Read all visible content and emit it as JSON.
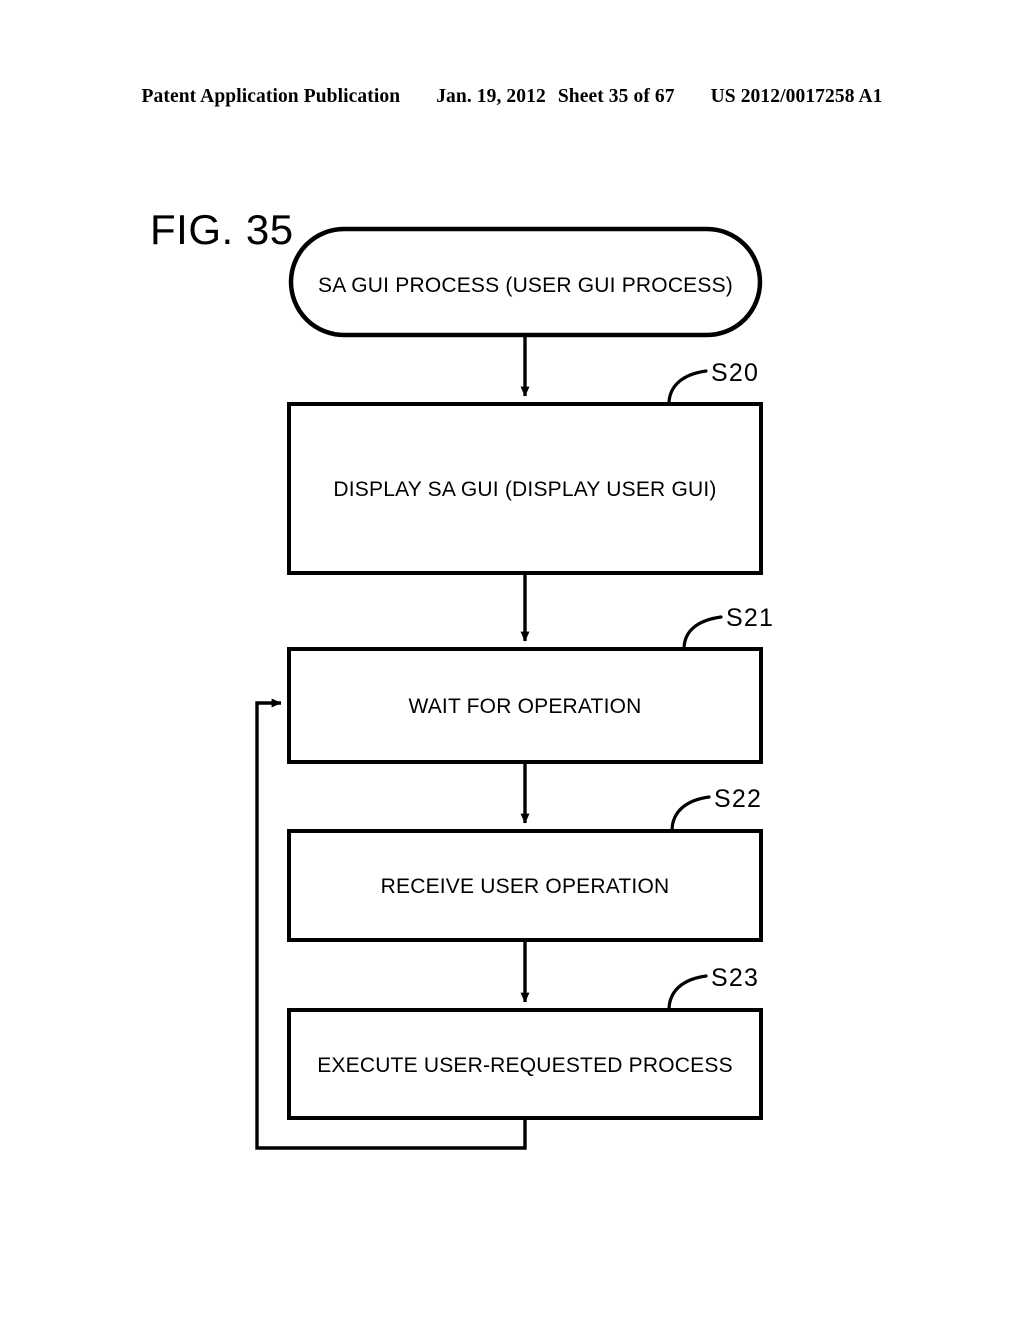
{
  "header": {
    "publication": "Patent Application Publication",
    "date": "Jan. 19, 2012",
    "sheet": "Sheet 35 of 67",
    "docnumber": "US 2012/0017258 A1"
  },
  "figure": {
    "label": "FIG. 35",
    "ink_color": "#000000",
    "background_color": "#ffffff"
  },
  "flowchart": {
    "terminal": {
      "text": "SA GUI PROCESS (USER GUI PROCESS)",
      "shape": "stadium"
    },
    "steps": [
      {
        "id": "S20",
        "text": "DISPLAY SA GUI (DISPLAY USER GUI)",
        "shape": "rectangle"
      },
      {
        "id": "S21",
        "text": "WAIT FOR OPERATION",
        "shape": "rectangle"
      },
      {
        "id": "S22",
        "text": "RECEIVE USER OPERATION",
        "shape": "rectangle"
      },
      {
        "id": "S23",
        "text": "EXECUTE USER-REQUESTED PROCESS",
        "shape": "rectangle"
      }
    ],
    "connectors": [
      {
        "from": "terminal",
        "to": "S20",
        "kind": "arrow-down"
      },
      {
        "from": "S20",
        "to": "S21",
        "kind": "arrow-down"
      },
      {
        "from": "S21",
        "to": "S22",
        "kind": "arrow-down"
      },
      {
        "from": "S22",
        "to": "S23",
        "kind": "arrow-down"
      },
      {
        "from": "S23",
        "to": "S21",
        "kind": "feedback-loop-left"
      }
    ]
  }
}
